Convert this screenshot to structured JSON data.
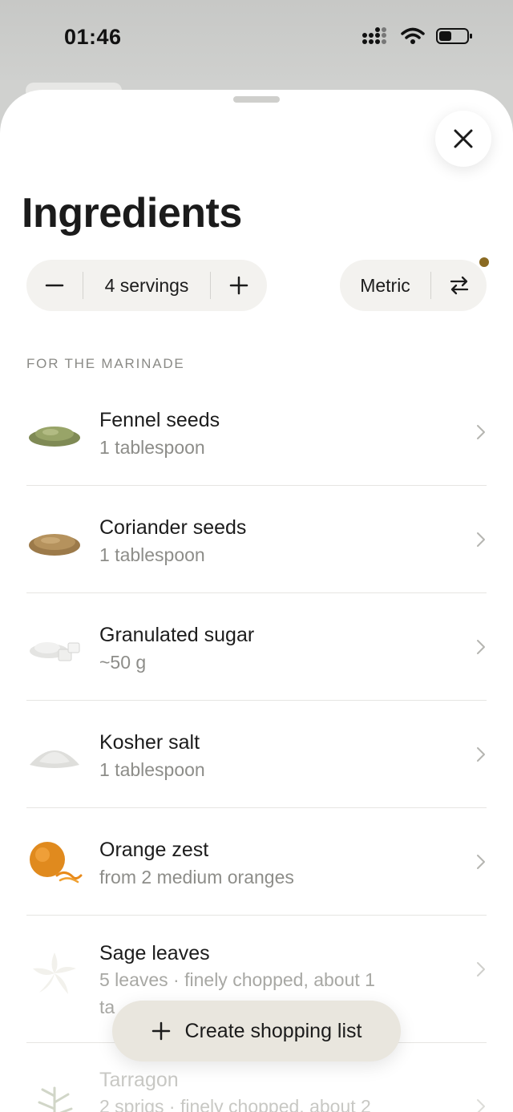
{
  "status_bar": {
    "time": "01:46"
  },
  "sheet": {
    "title": "Ingredients",
    "servings": {
      "decrease_icon": "minus-icon",
      "label": "4 servings",
      "increase_icon": "plus-icon"
    },
    "units": {
      "label": "Metric",
      "swap_icon": "swap-arrows-icon"
    },
    "close_icon": "close-icon"
  },
  "section": {
    "heading": "FOR THE MARINADE"
  },
  "ingredients": [
    {
      "name": "Fennel seeds",
      "quantity": "1 tablespoon"
    },
    {
      "name": "Coriander seeds",
      "quantity": "1 tablespoon"
    },
    {
      "name": "Granulated sugar",
      "quantity": "~50 g"
    },
    {
      "name": "Kosher salt",
      "quantity": "1 tablespoon"
    },
    {
      "name": "Orange zest",
      "quantity": "from 2 medium oranges"
    },
    {
      "name": "Sage leaves",
      "quantity": "5 leaves · finely chopped, about 1"
    },
    {
      "name": "Tarragon",
      "quantity": "2 sprigs · finely chopped, about 2"
    }
  ],
  "cta": {
    "label": "Create shopping list",
    "icon": "plus-icon"
  },
  "colors": {
    "accent_dot": "#8a6a22",
    "cta_bg": "#e9e6de",
    "pill_bg": "#f3f2ef"
  }
}
